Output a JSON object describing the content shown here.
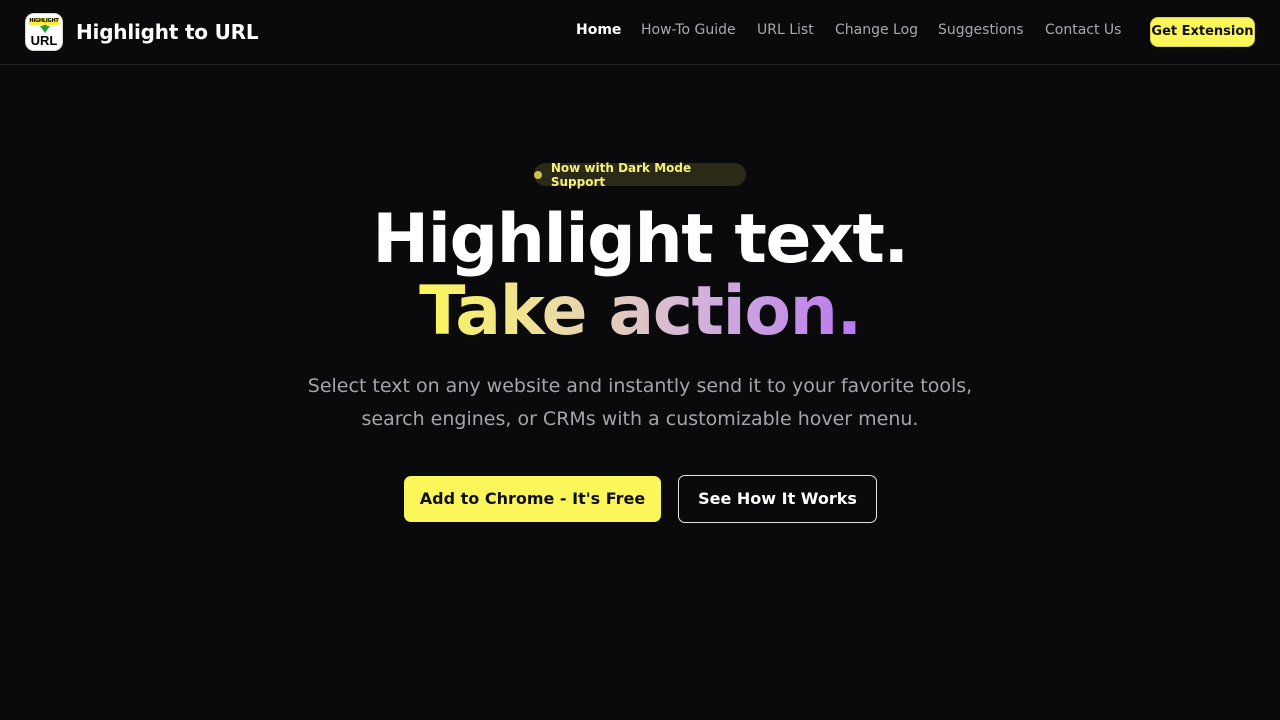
{
  "brand": {
    "logo_top_text": "HIGHLIGHT",
    "logo_bottom_text": "URL",
    "name": "Highlight to URL"
  },
  "nav": {
    "items": [
      {
        "label": "Home",
        "active": true
      },
      {
        "label": "How-To Guide",
        "active": false
      },
      {
        "label": "URL List",
        "active": false
      },
      {
        "label": "Change Log",
        "active": false
      },
      {
        "label": "Suggestions",
        "active": false
      },
      {
        "label": "Contact Us",
        "active": false
      }
    ],
    "cta_label": "Get Extension"
  },
  "hero": {
    "badge_text": "Now with Dark Mode Support",
    "headline_line1": "Highlight text.",
    "headline_line2": "Take action.",
    "subtitle": "Select text on any website and instantly send it to your favorite tools, search engines, or CRMs with a customizable hover menu.",
    "primary_button": "Add to Chrome - It's Free",
    "secondary_button": "See How It Works"
  },
  "colors": {
    "background": "#0a0a0c",
    "accent_yellow": "#fbf75a",
    "accent_purple": "#b877f0",
    "muted_text": "#a4a4ac"
  }
}
